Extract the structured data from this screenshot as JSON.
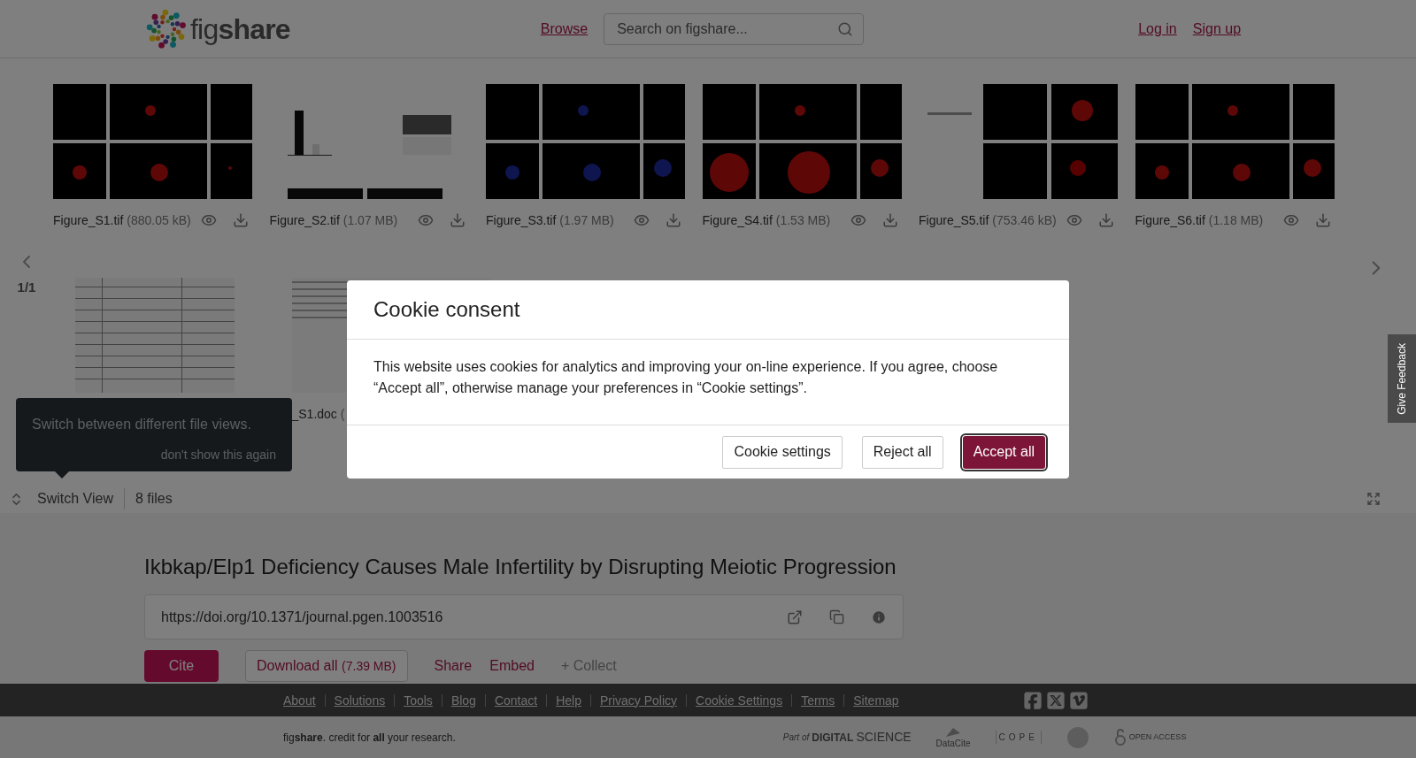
{
  "header": {
    "logo": "fig**share**",
    "nav_link": "Browse",
    "search": {
      "placeholder": "Search on figshare..."
    },
    "auth_links": [
      "Log in",
      "Sign up"
    ]
  },
  "gallery": {
    "page_indicator": "1/1",
    "rows": [
      [
        {
          "name": "Figure_S1.tif",
          "size": "(880.05 kB)"
        },
        {
          "name": "Figure_S2.tif",
          "size": "(1.07 MB)"
        },
        {
          "name": "Figure_S3.tif",
          "size": "(1.97 MB)"
        },
        {
          "name": "Figure_S4.tif",
          "size": "(1.53 MB)"
        },
        {
          "name": "Figure_S5.tif",
          "size": "(753.46 kB)"
        },
        {
          "name": "Figure_S6.tif",
          "size": "(1.18 MB)"
        }
      ],
      [
        {
          "kind": "picture"
        },
        {
          "name": "_S1.doc",
          "size": "("
        }
      ]
    ],
    "tooltip": {
      "text": "Switch between different file views.",
      "dismiss": "don't show this again"
    },
    "switch_view": "Switch View",
    "file_count": "8 files"
  },
  "item": {
    "title": "Ikbkap/Elp1 Deficiency Causes Male Infertility by Disrupting Meiotic Progression",
    "doi": "https://doi.org/10.1371/journal.pgen.1003516",
    "actions": {
      "cite": "Cite",
      "download_all": "Download all",
      "download_size": "(7.39 MB)",
      "links": [
        "Share",
        "Embed"
      ],
      "collect": "+ Collect"
    }
  },
  "footer": {
    "links": [
      "About",
      "Solutions",
      "Tools",
      "Blog",
      "Contact",
      "Help",
      "Privacy Policy",
      "Cookie Settings",
      "Terms",
      "Sitemap"
    ],
    "tagline": "fig**share**. credit for **all** your research.",
    "partners": {
      "digital_science_prefix": "Part of",
      "digital_science": "DIGITAL",
      "digital_science_suffix": "SCIENCE",
      "datacite": "DataCite",
      "cope": "COPE",
      "open_access": "OPEN ACCESS"
    }
  },
  "feedback_tab": "Give Feedback",
  "cookie_modal": {
    "title": "Cookie consent",
    "body": "This website uses cookies for analytics and improving your on-line experience. If you agree, choose “Accept all”, otherwise manage your preferences in “Cookie settings”.",
    "buttons": [
      "Cookie settings",
      "Reject all",
      "Accept all"
    ]
  }
}
